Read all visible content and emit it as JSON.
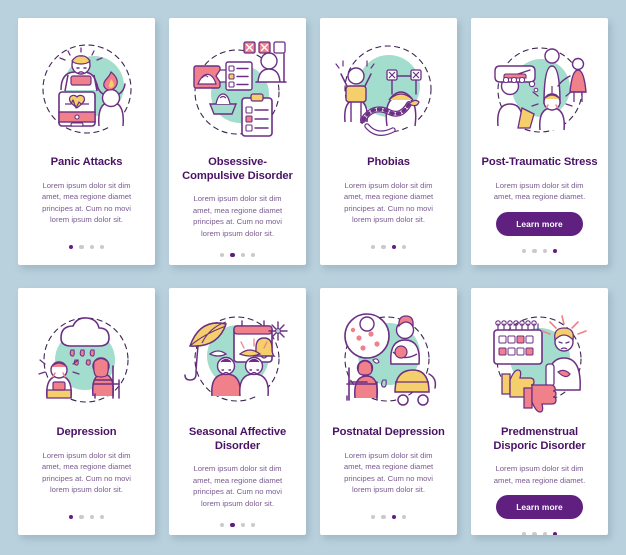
{
  "palette": {
    "background": "#b9d1dd",
    "card_background": "#ffffff",
    "title_color": "#4a1265",
    "body_text_color": "#7a5b92",
    "accent_purple": "#5f2080",
    "mint": "#a2ddcd",
    "coral": "#f0808a",
    "yellow": "#f5cf6b",
    "outline_purple": "#6b2f84",
    "dot_inactive": "#c9c9cf"
  },
  "screens": [
    {
      "id": "panic-attacks",
      "title": "Panic Attacks",
      "description": "Lorem ipsum dolor sit dim amet, mea regione diamet principes at. Cum no movi lorem ipsum dolor sit.",
      "illustration": "panic-attacks-illustration",
      "has_button": false,
      "button_label": "",
      "dots": {
        "count": 4,
        "active_index": 0
      }
    },
    {
      "id": "obsessive-compulsive-disorder",
      "title": "Obsessive-Compulsive Disorder",
      "description": "Lorem ipsum dolor sit dim amet, mea regione diamet principes at. Cum no movi lorem ipsum dolor sit.",
      "illustration": "obsessive-compulsive-disorder-illustration",
      "has_button": false,
      "button_label": "",
      "dots": {
        "count": 4,
        "active_index": 1
      }
    },
    {
      "id": "phobias",
      "title": "Phobias",
      "description": "Lorem ipsum dolor sit dim amet, mea regione diamet principes at. Cum no movi lorem ipsum dolor sit.",
      "illustration": "phobias-illustration",
      "has_button": false,
      "button_label": "",
      "dots": {
        "count": 4,
        "active_index": 2
      }
    },
    {
      "id": "post-traumatic-stress",
      "title": "Post-Traumatic Stress",
      "description": "Lorem ipsum dolor sit dim amet, mea regione diamet.",
      "illustration": "post-traumatic-stress-illustration",
      "has_button": true,
      "button_label": "Learn more",
      "dots": {
        "count": 4,
        "active_index": 3
      }
    },
    {
      "id": "depression",
      "title": "Depression",
      "description": "Lorem ipsum dolor sit dim amet, mea regione diamet principes at. Cum no movi lorem ipsum dolor sit.",
      "illustration": "depression-illustration",
      "has_button": false,
      "button_label": "",
      "dots": {
        "count": 4,
        "active_index": 0
      }
    },
    {
      "id": "seasonal-affective-disorder",
      "title": "Seasonal Affective Disorder",
      "description": "Lorem ipsum dolor sit dim amet, mea regione diamet principes at. Cum no movi lorem ipsum dolor sit.",
      "illustration": "seasonal-affective-disorder-illustration",
      "has_button": false,
      "button_label": "",
      "dots": {
        "count": 4,
        "active_index": 1
      }
    },
    {
      "id": "postnatal-depression",
      "title": "Postnatal Depression",
      "description": "Lorem ipsum dolor sit dim amet, mea regione diamet principes at. Cum no movi lorem ipsum dolor sit.",
      "illustration": "postnatal-depression-illustration",
      "has_button": false,
      "button_label": "",
      "dots": {
        "count": 4,
        "active_index": 2
      }
    },
    {
      "id": "predmenstrual-disporic-disorder",
      "title": "Predmenstrual Disporic Disorder",
      "description": "Lorem ipsum dolor sit dim amet, mea regione diamet.",
      "illustration": "predmenstrual-disporic-disorder-illustration",
      "has_button": true,
      "button_label": "Learn more",
      "dots": {
        "count": 4,
        "active_index": 3
      }
    }
  ]
}
